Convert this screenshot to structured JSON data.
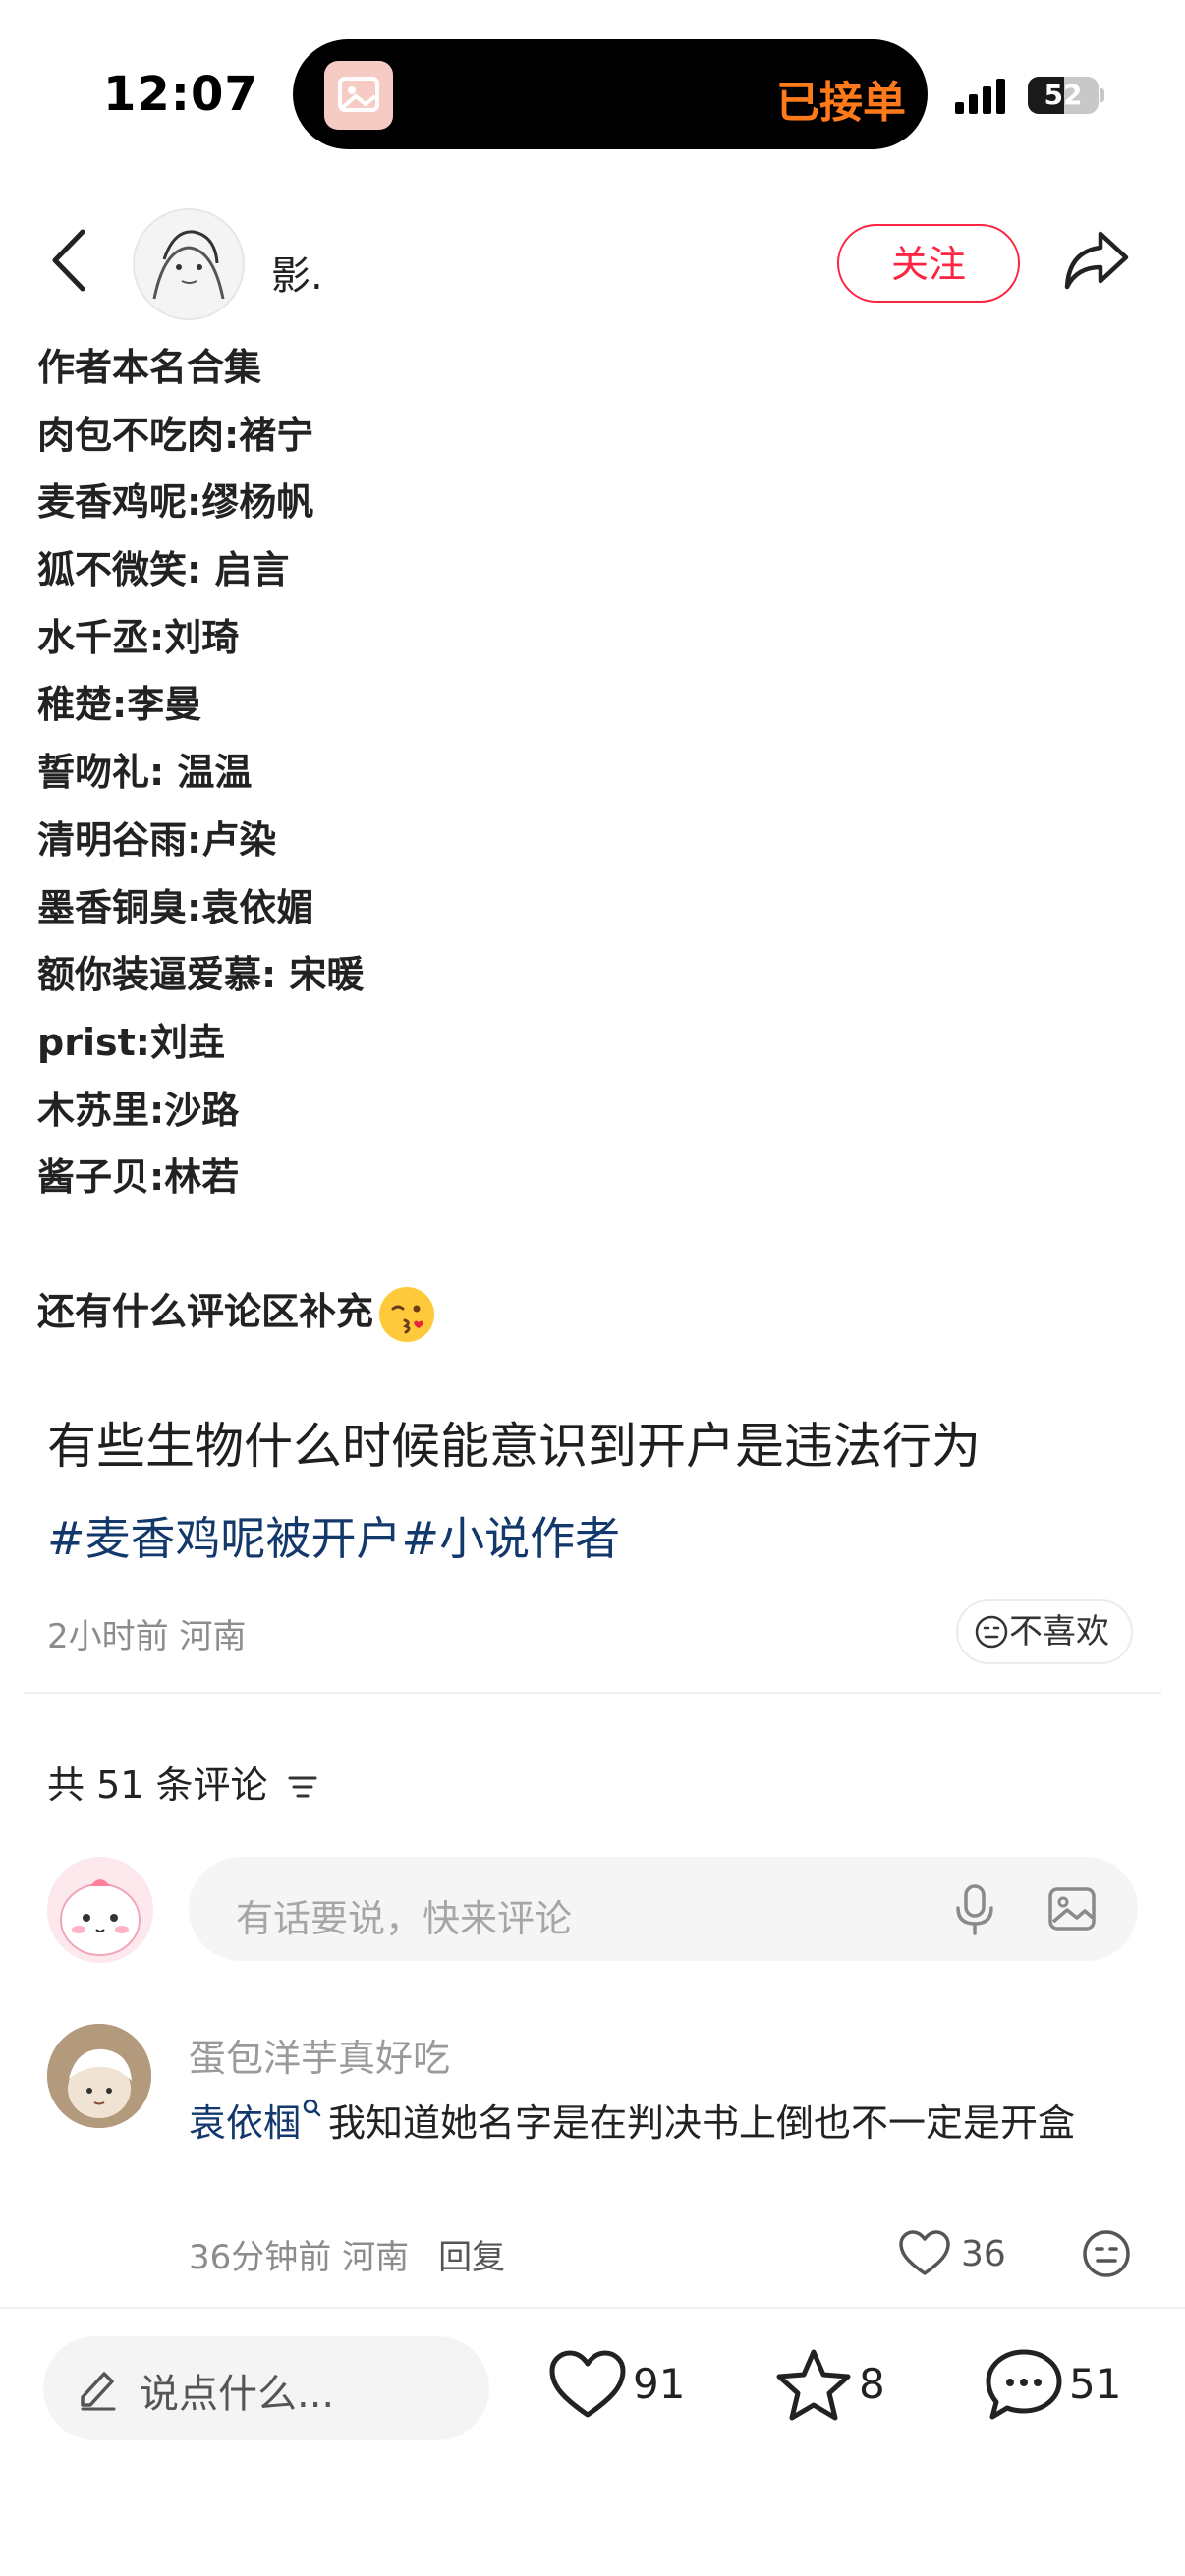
{
  "status_bar": {
    "time": "12:07",
    "island_text": "已接单",
    "battery": "52",
    "battery_level": 0.52
  },
  "header": {
    "back_icon": "chevron-left-icon",
    "author_name": "影.",
    "follow_label": "关注",
    "share_icon": "share-arrow-icon"
  },
  "post_image": {
    "lines": [
      "作者本名合集",
      "肉包不吃肉:褚宁",
      "麦香鸡呢:缪杨帆",
      "狐不微笑:  启言",
      "水千丞:刘琦",
      "稚楚:李曼",
      "誓吻礼:  温温",
      "清明谷雨:卢染",
      "墨香铜臭:袁依媚",
      "额你装逼爱慕:  宋暖",
      "prist:刘垚",
      "木苏里:沙路",
      "酱子贝:林若"
    ],
    "extra": "还有什么评论区补充",
    "emoji": "kiss-emoji-icon"
  },
  "post": {
    "title": "有些生物什么时候能意识到开户是违法行为",
    "tags": "#麦香鸡呢被开户#小说作者",
    "meta": "2小时前 河南",
    "dislike_label": "不喜欢"
  },
  "comments": {
    "count_label": "共 51 条评论",
    "input_placeholder": "有话要说，快来评论",
    "items": [
      {
        "user": "蛋包洋芋真好吃",
        "mention": "袁依椢",
        "text": "我知道她名字是在判决书上倒也不一定是开盒",
        "time_location": "36分钟前 河南",
        "reply_label": "回复",
        "likes": "36"
      }
    ]
  },
  "bottom_bar": {
    "say_placeholder": "说点什么...",
    "likes": "91",
    "stars": "8",
    "comments": "51"
  },
  "colors": {
    "accent_red": "#ff2442",
    "tag_blue": "#13386c",
    "island_orange": "#ff7a1a"
  }
}
